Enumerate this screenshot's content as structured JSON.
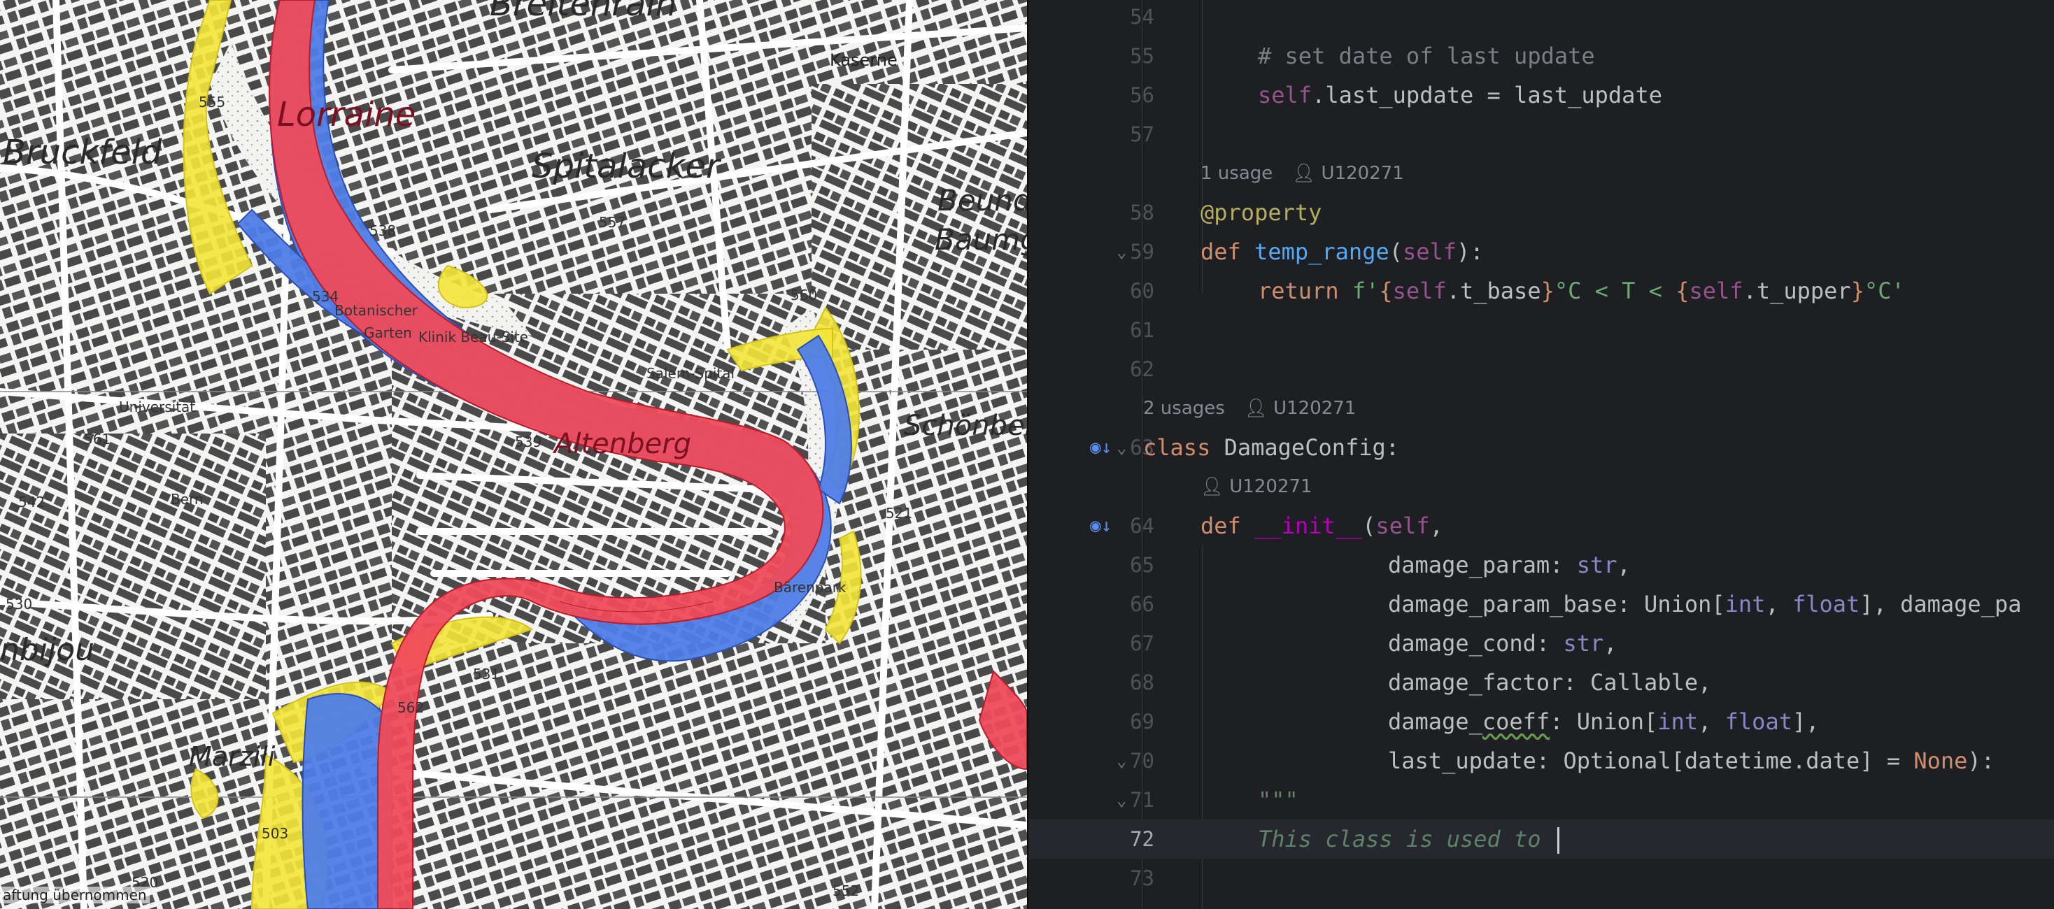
{
  "map": {
    "labels": {
      "breitenrain": "Breitenrain",
      "lorraine": "Lorraine",
      "bruckfeld": "Bruckfeld",
      "spitalacker": "Spitalacker",
      "beunde": "Beunde",
      "baumg": "Baumg",
      "kaserne": "Kaserne",
      "botanischer": "Botanischer",
      "garten": "Garten",
      "klinik": "Klinik Beau-Site",
      "salem": "Salem-Spital",
      "universitat": "Universität",
      "schonberg": "Schönberg",
      "altenberg": "Altenberg",
      "bern": "Bern",
      "barenpark": "Bärenpark",
      "bijou": "nbijou",
      "marzili": "Marzili",
      "e555": "555",
      "e538": "538",
      "e557": "557",
      "e560": "560",
      "e534": "534",
      "e561": "561",
      "e542": "542",
      "e539": "539",
      "e521": "521",
      "e530": "530",
      "e531": "531",
      "e503": "503",
      "e520": "520",
      "e552": "552",
      "e562": "562"
    },
    "attribution": "aftung übernommen",
    "hazard_colors": {
      "high": "#ef4b5a",
      "medium": "#4f7de6",
      "low": "#f4e63a"
    }
  },
  "editor": {
    "current_line": "72",
    "lines": [
      {
        "num": "54"
      },
      {
        "num": "55",
        "comment": "# set date of last update"
      },
      {
        "num": "56",
        "self": "self",
        "rest": ".last_update = last_update"
      },
      {
        "num": "57"
      },
      {
        "hint": {
          "usages": "1 usage",
          "author": "U120271"
        }
      },
      {
        "num": "58",
        "decorator": "@property"
      },
      {
        "num": "59",
        "kw": "def",
        "name": "temp_range",
        "open": "(",
        "self": "self",
        "close": "):"
      },
      {
        "num": "60",
        "kw": "return",
        "f": " f'",
        "b1": "{",
        "s1": "self",
        "a1": ".t_base",
        "b2": "}",
        "t1": "°C < T < ",
        "b3": "{",
        "s2": "self",
        "a2": ".t_upper",
        "b4": "}",
        "t2": "°C'"
      },
      {
        "num": "61"
      },
      {
        "num": "62"
      },
      {
        "hint": {
          "usages": "2 usages",
          "author": "U120271"
        }
      },
      {
        "num": "63",
        "kw": "class",
        "rest": " DamageConfig:"
      },
      {
        "hint": {
          "usages": "",
          "author": "U120271"
        }
      },
      {
        "num": "64",
        "kw": "def",
        "name": "__init__",
        "open": "(",
        "self": "self",
        "close": ","
      },
      {
        "num": "65",
        "p": "damage_param: ",
        "t": "str",
        "tail": ","
      },
      {
        "num": "66",
        "p": "damage_param_base: Union[",
        "t": "int",
        "mid": ", ",
        "t2": "float",
        "tail": "], damage_pa"
      },
      {
        "num": "67",
        "p": "damage_cond: ",
        "t": "str",
        "tail": ","
      },
      {
        "num": "68",
        "p": "damage_factor: Callable,"
      },
      {
        "num": "69",
        "p1": "damage_",
        "p2": "coeff",
        "p3": ": Union[",
        "t": "int",
        "mid": ", ",
        "t2": "float",
        "tail": "],"
      },
      {
        "num": "70",
        "p": "last_update: Optional[datetime.date] = ",
        "kwv": "None",
        "tail": "):"
      },
      {
        "num": "71",
        "doc": "\"\"\""
      },
      {
        "num": "72",
        "doc": "This class is used to "
      },
      {
        "num": "73"
      }
    ]
  }
}
